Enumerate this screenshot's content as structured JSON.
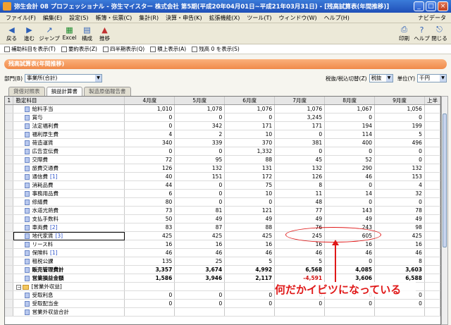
{
  "window": {
    "title": "弥生会計 08 プロフェッショナル - 弥生マイスター 株式会社 第5期(平成20年04月01日~平成21年03月31日) - [残高試算表(年間推移)]",
    "minimize": "_",
    "restore": "□",
    "close": "×"
  },
  "menu": {
    "items": [
      "ファイル(F)",
      "編集(E)",
      "設定(S)",
      "帳簿・伝票(C)",
      "集計(R)",
      "決算・申告(K)",
      "拡張機能(X)",
      "ツール(T)",
      "ウィンドウ(W)",
      "ヘルプ(H)"
    ],
    "navi": "ナビデータ"
  },
  "toolbar": {
    "back": "戻る",
    "forward": "進む",
    "jump": "ジャンプ",
    "excel": "Excel",
    "compose": "構成",
    "graph": "推移",
    "print": "印刷",
    "help": "ヘルプ",
    "close": "閉じる"
  },
  "checks": [
    "補助科目を表示(T)",
    "要約表示(Z)",
    "四半期表示(Q)",
    "積上表示(A)",
    "残高 0 を表示(S)"
  ],
  "report_title": "残高試算表(年間推移)",
  "filters": {
    "dept_label": "部門(B)",
    "dept_value": "事業所(合計)",
    "tax_label": "税抜/税込切替(Z)",
    "tax_value": "税抜",
    "unit_label": "単位(Y)",
    "unit_value": "千円"
  },
  "tabs": [
    "貸借対照表",
    "損益計算書",
    "製造原価報告書"
  ],
  "table": {
    "headers": [
      "勘定科目",
      "4月度",
      "5月度",
      "6月度",
      "7月度",
      "8月度",
      "9月度",
      "上半"
    ],
    "row_number": "1",
    "rows": [
      {
        "name": "給料手当",
        "suffix": "",
        "vals": [
          "1,010",
          "1,078",
          "1,076",
          "1,076",
          "1,067",
          "1,056"
        ]
      },
      {
        "name": "賞与",
        "suffix": "",
        "vals": [
          "0",
          "0",
          "0",
          "3,245",
          "0",
          "0"
        ]
      },
      {
        "name": "法定福利費",
        "suffix": "",
        "vals": [
          "0",
          "342",
          "171",
          "171",
          "194",
          "199"
        ]
      },
      {
        "name": "福利厚生費",
        "suffix": "",
        "vals": [
          "4",
          "2",
          "10",
          "0",
          "114",
          "5"
        ]
      },
      {
        "name": "荷造運賃",
        "suffix": "",
        "vals": [
          "340",
          "339",
          "370",
          "381",
          "400",
          "496"
        ]
      },
      {
        "name": "広告宣伝費",
        "suffix": "",
        "vals": [
          "0",
          "0",
          "1,332",
          "0",
          "0",
          "0"
        ]
      },
      {
        "name": "交際費",
        "suffix": "",
        "vals": [
          "72",
          "95",
          "88",
          "45",
          "52",
          "0"
        ]
      },
      {
        "name": "旅費交通費",
        "suffix": "",
        "vals": [
          "126",
          "132",
          "131",
          "132",
          "290",
          "132"
        ]
      },
      {
        "name": "通信費",
        "suffix": "[1]",
        "vals": [
          "40",
          "151",
          "172",
          "126",
          "46",
          "153"
        ]
      },
      {
        "name": "消耗品費",
        "suffix": "",
        "vals": [
          "44",
          "0",
          "75",
          "8",
          "0",
          "4"
        ]
      },
      {
        "name": "事務用品費",
        "suffix": "",
        "vals": [
          "6",
          "0",
          "10",
          "11",
          "14",
          "32"
        ]
      },
      {
        "name": "修繕費",
        "suffix": "",
        "vals": [
          "80",
          "0",
          "0",
          "48",
          "0",
          "0"
        ]
      },
      {
        "name": "水道光熱費",
        "suffix": "",
        "vals": [
          "73",
          "81",
          "121",
          "77",
          "143",
          "78"
        ]
      },
      {
        "name": "支払手数料",
        "suffix": "",
        "vals": [
          "50",
          "49",
          "49",
          "49",
          "49",
          "49"
        ]
      },
      {
        "name": "車両費",
        "suffix": "[2]",
        "vals": [
          "83",
          "87",
          "88",
          "76",
          "243",
          "98"
        ]
      },
      {
        "name": "地代家賃",
        "suffix": "[3]",
        "vals": [
          "425",
          "425",
          "425",
          "245",
          "605",
          "425"
        ]
      },
      {
        "name": "リース料",
        "suffix": "",
        "vals": [
          "16",
          "16",
          "16",
          "16",
          "16",
          "16"
        ]
      },
      {
        "name": "保険料",
        "suffix": "[1]",
        "vals": [
          "46",
          "46",
          "46",
          "46",
          "46",
          "46"
        ]
      },
      {
        "name": "租税公課",
        "suffix": "",
        "vals": [
          "135",
          "25",
          "5",
          "5",
          "0",
          "8"
        ]
      },
      {
        "name": "販売管理費計",
        "suffix": "",
        "vals": [
          "3,357",
          "3,674",
          "4,992",
          "6,568",
          "4,085",
          "3,603"
        ]
      },
      {
        "name": "営業損益金額",
        "suffix": "",
        "vals": [
          "1,586",
          "3,946",
          "2,117",
          "-4,591",
          "3,606",
          "6,588"
        ]
      },
      {
        "name": "[営業外収益]",
        "suffix": "",
        "vals": [
          "",
          "",
          "",
          "",
          "",
          ""
        ]
      },
      {
        "name": "受取利息",
        "suffix": "",
        "vals": [
          "0",
          "0",
          "0",
          "0",
          "0",
          "0"
        ]
      },
      {
        "name": "受取配当金",
        "suffix": "",
        "vals": [
          "0",
          "0",
          "0",
          "0",
          "0",
          "0"
        ]
      },
      {
        "name": "営業外収益合計",
        "suffix": "",
        "vals": [
          "",
          "",
          "",
          "",
          "",
          ""
        ]
      }
    ]
  },
  "annotation": "何だかイビツになっている",
  "colors": {
    "accent_orange": "#f08a4a",
    "annotation_red": "#e01818",
    "title_blue": "#1f4fb8"
  }
}
